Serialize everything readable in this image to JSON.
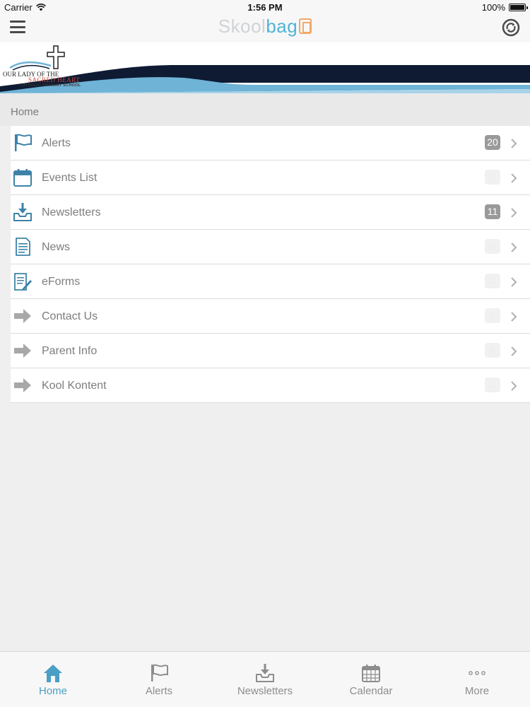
{
  "status_bar": {
    "carrier": "Carrier",
    "time": "1:56 PM",
    "battery": "100%"
  },
  "nav": {
    "brand_part1": "Skool",
    "brand_part2": "bag"
  },
  "banner": {
    "school_line1": "OUR LADY OF THE",
    "school_line2": "SACRED HEART",
    "school_line3": "CATHOLIC PRIMARY SCHOOL"
  },
  "breadcrumb": "Home",
  "menu": {
    "items": [
      {
        "label": "Alerts",
        "badge": "20",
        "icon": "flag-icon"
      },
      {
        "label": "Events List",
        "badge": "0",
        "icon": "calendar-icon"
      },
      {
        "label": "Newsletters",
        "badge": "11",
        "icon": "inbox-download-icon"
      },
      {
        "label": "News",
        "badge": "0",
        "icon": "document-icon"
      },
      {
        "label": "eForms",
        "badge": "0",
        "icon": "form-pencil-icon"
      },
      {
        "label": "Contact Us",
        "badge": "0",
        "icon": "arrow-right-icon"
      },
      {
        "label": "Parent Info",
        "badge": "0",
        "icon": "arrow-right-icon"
      },
      {
        "label": "Kool Kontent",
        "badge": "0",
        "icon": "arrow-right-icon"
      }
    ]
  },
  "tabs": [
    {
      "label": "Home",
      "icon": "home-icon",
      "active": true
    },
    {
      "label": "Alerts",
      "icon": "flag-icon"
    },
    {
      "label": "Newsletters",
      "icon": "inbox-download-icon"
    },
    {
      "label": "Calendar",
      "icon": "calendar-grid-icon"
    },
    {
      "label": "More",
      "icon": "more-dots-icon"
    }
  ],
  "colors": {
    "accent": "#4a9fc4",
    "icon_blue": "#3d82a8",
    "badge_active": "#9a9a9a",
    "banner_navy": "#0e1b33",
    "banner_light_blue": "#6fb3d6"
  }
}
